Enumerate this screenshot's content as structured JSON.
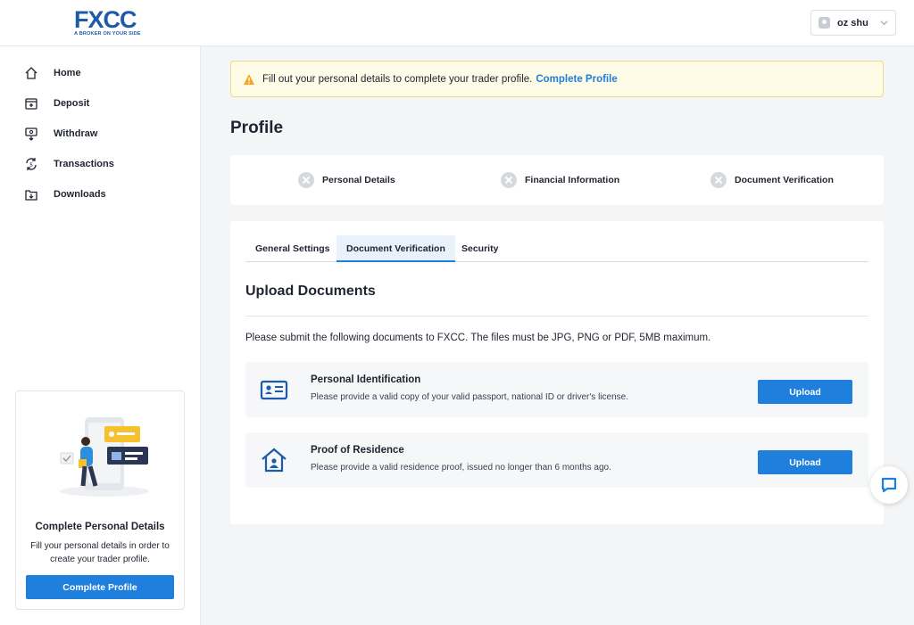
{
  "brand": {
    "logo_text": "FXCC",
    "tagline": "A BROKER ON YOUR SIDE",
    "accent": "#1e7fdc"
  },
  "header": {
    "user_name": "oz shu"
  },
  "sidebar": {
    "items": [
      {
        "label": "Home",
        "icon": "home-icon"
      },
      {
        "label": "Deposit",
        "icon": "deposit-icon"
      },
      {
        "label": "Withdraw",
        "icon": "withdraw-icon"
      },
      {
        "label": "Transactions",
        "icon": "transactions-icon"
      },
      {
        "label": "Downloads",
        "icon": "downloads-icon"
      }
    ],
    "promo": {
      "title": "Complete Personal Details",
      "text": "Fill your personal details in order to create your trader profile.",
      "button": "Complete Profile"
    }
  },
  "alert": {
    "message": "Fill out your personal details to complete your trader profile.",
    "link": "Complete Profile",
    "color": "#f5a623"
  },
  "page": {
    "title": "Profile"
  },
  "steps": [
    {
      "label": "Personal Details"
    },
    {
      "label": "Financial Information"
    },
    {
      "label": "Document Verification"
    }
  ],
  "tabs": [
    {
      "label": "General Settings",
      "active": false
    },
    {
      "label": "Document Verification",
      "active": true
    },
    {
      "label": "Security",
      "active": false
    }
  ],
  "upload": {
    "title": "Upload Documents",
    "intro": "Please submit the following documents to FXCC. The files must be JPG, PNG or PDF, 5MB maximum.",
    "documents": [
      {
        "title": "Personal Identification",
        "desc": "Please provide a valid copy of your valid passport, national ID or driver's license.",
        "button": "Upload",
        "icon": "id-card-icon"
      },
      {
        "title": "Proof of Residence",
        "desc": "Please provide a valid residence proof, issued no longer than 6 months ago.",
        "button": "Upload",
        "icon": "house-icon"
      }
    ]
  }
}
